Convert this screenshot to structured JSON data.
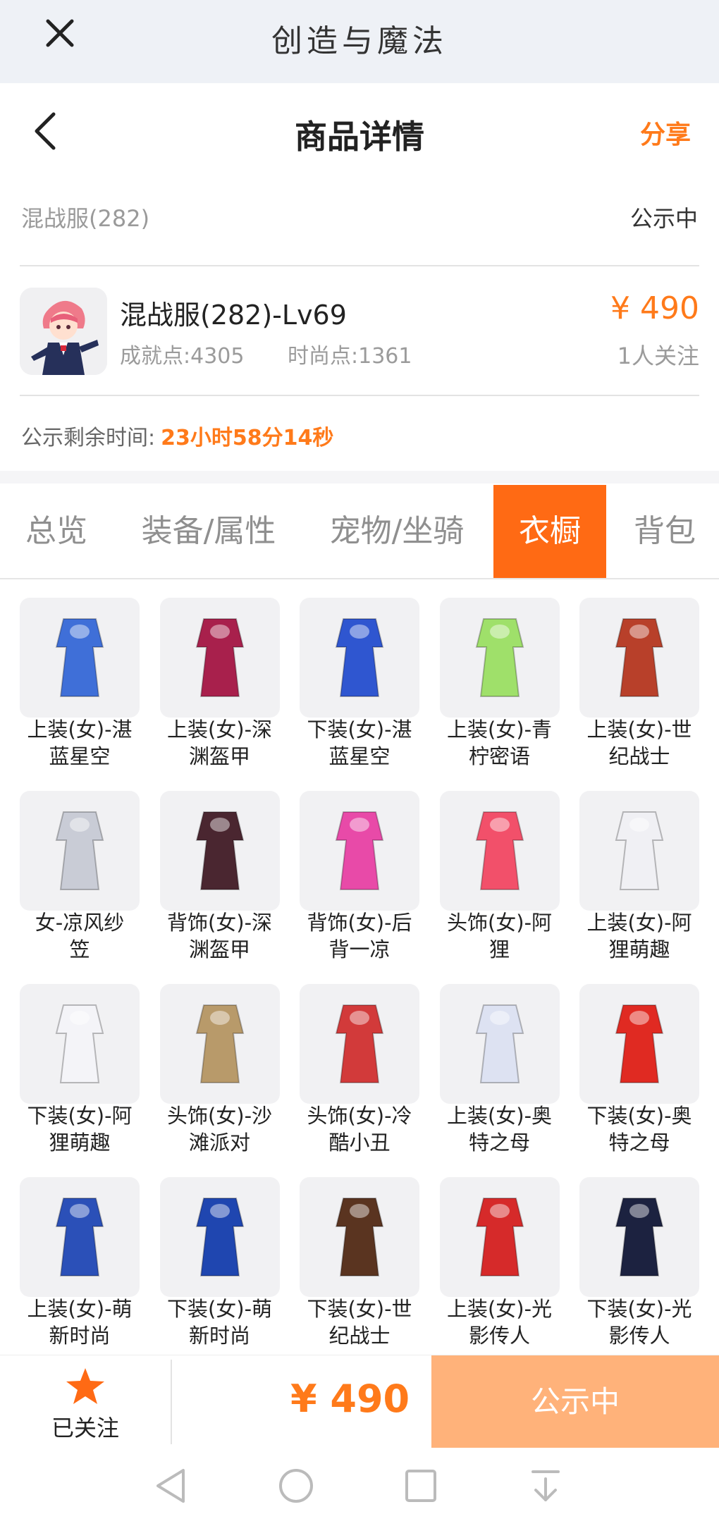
{
  "window": {
    "title": "创造与魔法"
  },
  "header": {
    "title": "商品详情",
    "share_label": "分享"
  },
  "listing": {
    "server": "混战服(282)",
    "status": "公示中",
    "name": "混战服(282)-Lv69",
    "achievement": "成就点:4305",
    "fashion": "时尚点:1361",
    "price": "¥ 490",
    "followers": "1人关注",
    "remain_label": "公示剩余时间:",
    "remain_time": "23小时58分14秒"
  },
  "tabs": [
    {
      "label": "总览"
    },
    {
      "label": "装备/属性"
    },
    {
      "label": "宠物/坐骑"
    },
    {
      "label": "衣橱",
      "active": true
    },
    {
      "label": "背包"
    }
  ],
  "wardrobe": [
    {
      "line1": "上装(女)-湛",
      "line2": "蓝星空",
      "icon": "blue-starry-dress-icon",
      "color": "#3f6fd8"
    },
    {
      "line1": "上装(女)-深",
      "line2": "渊盔甲",
      "icon": "abyss-armor-top-icon",
      "color": "#a8204c"
    },
    {
      "line1": "下装(女)-湛",
      "line2": "蓝星空",
      "icon": "blue-high-heels-icon",
      "color": "#2f56d0"
    },
    {
      "line1": "上装(女)-青",
      "line2": "柠密语",
      "icon": "green-lime-dress-icon",
      "color": "#9fe06a"
    },
    {
      "line1": "上装(女)-世",
      "line2": "纪战士",
      "icon": "century-warrior-top-icon",
      "color": "#b8402a"
    },
    {
      "line1": "女-凉风纱",
      "line2": "笠",
      "icon": "veil-hat-icon",
      "color": "#c9ccd6"
    },
    {
      "line1": "背饰(女)-深",
      "line2": "渊盔甲",
      "icon": "abyss-blade-back-icon",
      "color": "#4a2630"
    },
    {
      "line1": "背饰(女)-后",
      "line2": "背一凉",
      "icon": "ice-cream-back-icon",
      "color": "#e84aa8"
    },
    {
      "line1": "头饰(女)-阿",
      "line2": "狸",
      "icon": "fox-head-icon",
      "color": "#f2506a"
    },
    {
      "line1": "上装(女)-阿",
      "line2": "狸萌趣",
      "icon": "white-jacket-icon",
      "color": "#f0f0f4"
    },
    {
      "line1": "下装(女)-阿",
      "line2": "狸萌趣",
      "icon": "white-stockings-icon",
      "color": "#f4f4f8"
    },
    {
      "line1": "头饰(女)-沙",
      "line2": "滩派对",
      "icon": "beach-hat-icon",
      "color": "#b89a6a"
    },
    {
      "line1": "头饰(女)-冷",
      "line2": "酷小丑",
      "icon": "clown-pigtails-icon",
      "color": "#d23a3a"
    },
    {
      "line1": "上装(女)-奥",
      "line2": "特之母",
      "icon": "ultra-mother-top-icon",
      "color": "#dde2f2"
    },
    {
      "line1": "下装(女)-奥",
      "line2": "特之母",
      "icon": "red-boots-icon",
      "color": "#e02a22"
    },
    {
      "line1": "上装(女)-萌",
      "line2": "新时尚",
      "icon": "blue-qipao-top-icon",
      "color": "#2b50b8"
    },
    {
      "line1": "下装(女)-萌",
      "line2": "新时尚",
      "icon": "blue-trousers-icon",
      "color": "#1f46b0"
    },
    {
      "line1": "下装(女)-世",
      "line2": "纪战士",
      "icon": "brown-boots-icon",
      "color": "#5a3420"
    },
    {
      "line1": "上装(女)-光",
      "line2": "影传人",
      "icon": "red-jacket-icon",
      "color": "#d62a2a"
    },
    {
      "line1": "下装(女)-光",
      "line2": "影传人",
      "icon": "navy-skirt-icon",
      "color": "#1c2240"
    }
  ],
  "bottom": {
    "follow_label": "已关注",
    "price": "¥ 490",
    "action_label": "公示中"
  },
  "colors": {
    "accent": "#ff7a1a",
    "active_tab": "#ff6a14",
    "action_button": "#ffb27a"
  }
}
